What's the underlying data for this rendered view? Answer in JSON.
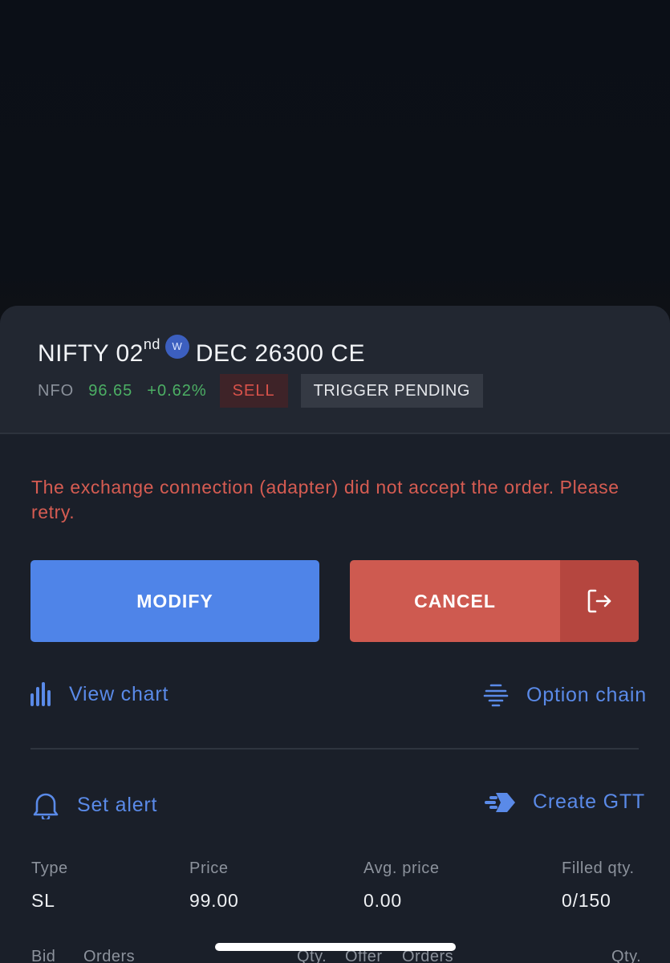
{
  "instrument": {
    "name": "NIFTY 02",
    "ordinal": "nd",
    "weekly_badge": "W",
    "rest": "DEC 26300 CE",
    "exchange": "NFO",
    "ltp": "96.65",
    "change": "+0.62%",
    "side": "SELL",
    "status": "TRIGGER PENDING"
  },
  "error_message": "The exchange connection (adapter) did not accept the order. Please retry.",
  "actions": {
    "modify_label": "MODIFY",
    "cancel_label": "CANCEL",
    "cancel_icon": "exit-icon"
  },
  "links": {
    "view_chart": "View chart",
    "option_chain": "Option chain",
    "set_alert": "Set alert",
    "create_gtt": "Create GTT"
  },
  "order_details": [
    {
      "label": "Type",
      "value": "SL"
    },
    {
      "label": "Price",
      "value": "99.00"
    },
    {
      "label": "Avg. price",
      "value": "0.00"
    },
    {
      "label": "Filled qty.",
      "value": "0/150"
    }
  ],
  "market_depth_headers": [
    "Bid",
    "Orders",
    "Qty.",
    "Offer",
    "Orders",
    "Qty."
  ],
  "colors": {
    "accent_blue": "#4f84e8",
    "danger_red": "#ce5a50",
    "positive_green": "#4caf64",
    "sheet_bg": "#1a1f29"
  }
}
